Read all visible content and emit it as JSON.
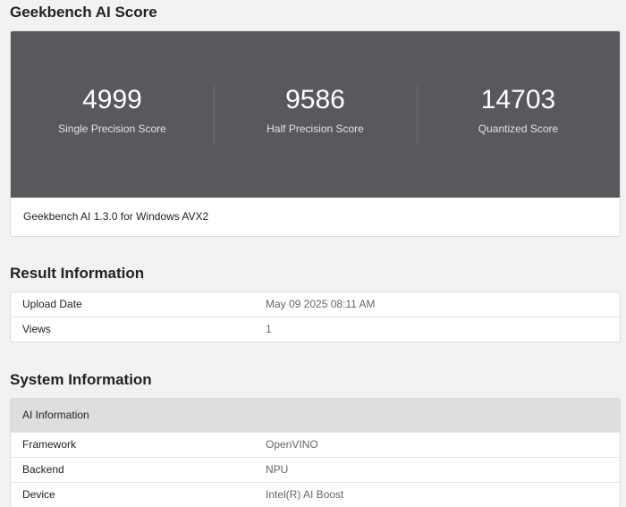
{
  "score_section": {
    "title": "Geekbench AI Score",
    "scores": [
      {
        "value": "4999",
        "label": "Single Precision Score"
      },
      {
        "value": "9586",
        "label": "Half Precision Score"
      },
      {
        "value": "14703",
        "label": "Quantized Score"
      }
    ],
    "version": "Geekbench AI 1.3.0 for Windows AVX2"
  },
  "result_info": {
    "title": "Result Information",
    "rows": [
      {
        "key": "Upload Date",
        "value": "May 09 2025 08:11 AM"
      },
      {
        "key": "Views",
        "value": "1"
      }
    ]
  },
  "system_info": {
    "title": "System Information",
    "group": "AI Information",
    "rows": [
      {
        "key": "Framework",
        "value": "OpenVINO"
      },
      {
        "key": "Backend",
        "value": "NPU"
      },
      {
        "key": "Device",
        "value": "Intel(R) AI Boost"
      }
    ]
  }
}
